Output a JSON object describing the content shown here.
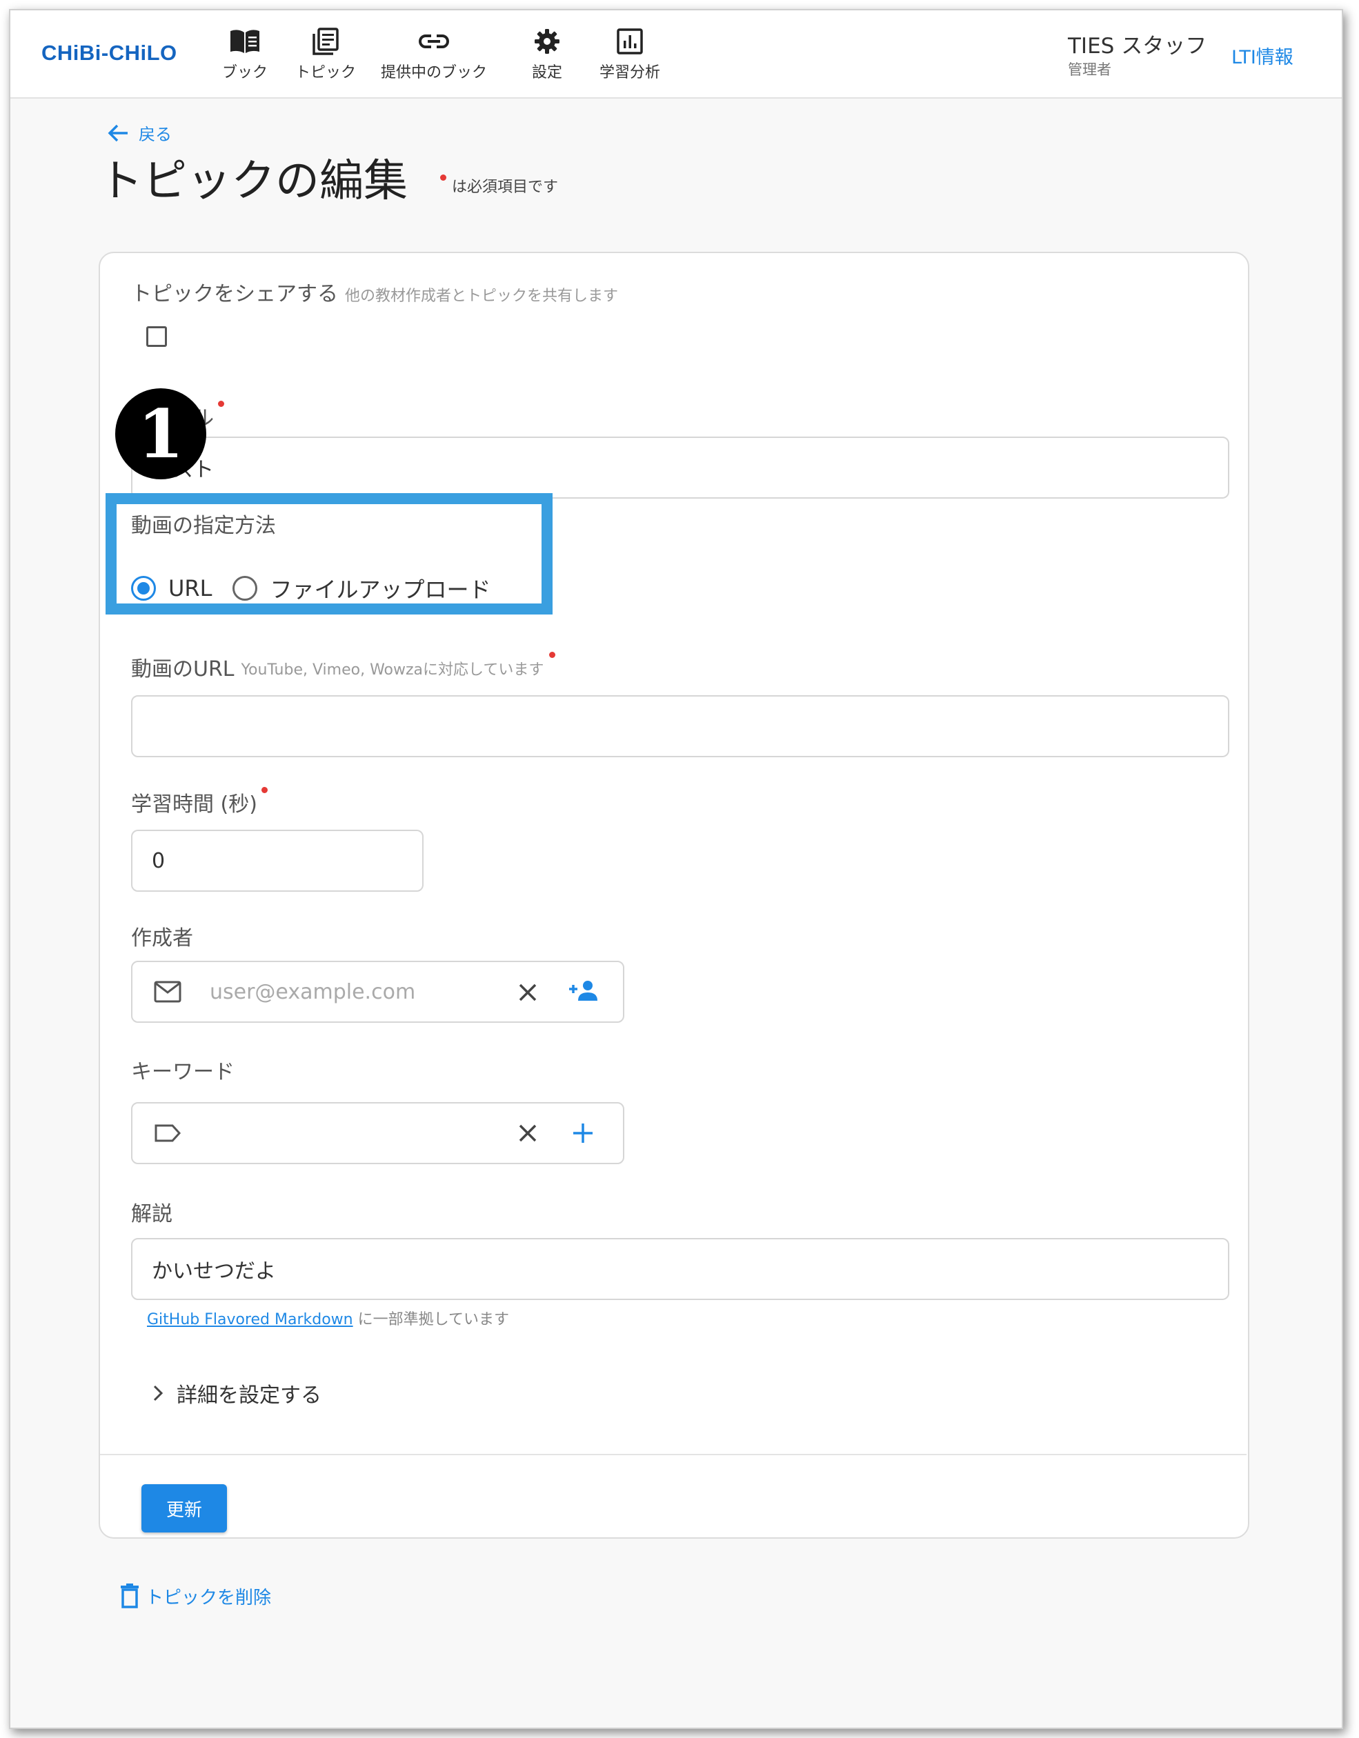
{
  "header": {
    "logo": "CHiBi-CHiLO",
    "nav": [
      {
        "label": "ブック",
        "icon": "book-icon"
      },
      {
        "label": "トピック",
        "icon": "topic-icon"
      },
      {
        "label": "提供中のブック",
        "icon": "link-icon"
      },
      {
        "label": "設定",
        "icon": "gear-icon"
      },
      {
        "label": "学習分析",
        "icon": "analytics-icon"
      }
    ],
    "user_name": "TIES スタッフ",
    "user_role": "管理者",
    "lti_link": "LTI情報"
  },
  "page": {
    "back_label": "戻る",
    "title": "トピックの編集",
    "required_note": "は必須項目です"
  },
  "form": {
    "share": {
      "label": "トピックをシェアする",
      "hint": "他の教材作成者とトピックを共有します",
      "checked": false
    },
    "title_field": {
      "label": "タイトル",
      "value": "テスト"
    },
    "video_method": {
      "label": "動画の指定方法",
      "options": [
        {
          "label": "URL",
          "selected": true
        },
        {
          "label": "ファイルアップロード",
          "selected": false
        }
      ]
    },
    "video_url": {
      "label": "動画のURL",
      "hint": "YouTube, Vimeo, Wowzaに対応しています",
      "value": ""
    },
    "study_time": {
      "label": "学習時間 (秒)",
      "value": "0"
    },
    "author": {
      "label": "作成者",
      "placeholder": "user@example.com"
    },
    "keyword": {
      "label": "キーワード",
      "value": ""
    },
    "description": {
      "label": "解説",
      "value": "かいせつだよ"
    },
    "markdown_link": "GitHub Flavored Markdown",
    "markdown_note": "に一部準拠しています",
    "details_label": "詳細を設定する",
    "update_button": "更新"
  },
  "delete_label": "トピックを削除",
  "annotation_badge": "1",
  "colors": {
    "accent": "#1e88e5",
    "highlight": "#3a9fe0",
    "required": "#e53935"
  }
}
